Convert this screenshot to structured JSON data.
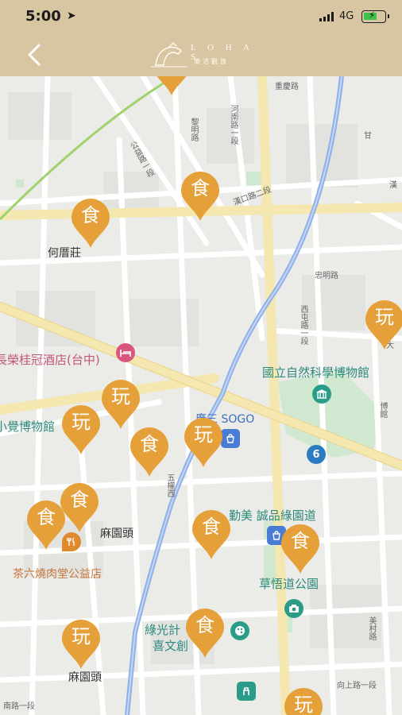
{
  "status_bar": {
    "time": "5:00",
    "network": "4G"
  },
  "header": {
    "logo_text": "L O H A S",
    "logo_subtitle": "樂活觀旅"
  },
  "map": {
    "labels": {
      "heli_zhuang": "何厝莊",
      "hotel": "長榮桂冠酒店(台中)",
      "museum_visual": "小覺博物館",
      "science_museum": "國立自然科學博物館",
      "sogo": "廣三 SOGO",
      "qinmei": "勤美 誠品綠園道",
      "matoutou_1": "麻園頭",
      "matoutou_2": "麻園頭",
      "tea_shop": "茶六燒肉堂公益店",
      "park": "草悟道公園",
      "green_light": "綠光計",
      "xiwen": "喜文創",
      "road_chongde": "重慶路",
      "road_hexin": "河南路一段",
      "road_liming": "黎明路",
      "road_gongyi": "公益路一段",
      "road_hankou": "漢口路二段",
      "road_zhongming": "忠明路",
      "road_ximing": "西屯路一段",
      "road_xiangshang": "向上路一段",
      "road_nan": "南路一段",
      "road_meicun": "美村路",
      "road_wuquan": "五權西",
      "road_boguan": "博館",
      "road_han": "漢",
      "road_da": "大",
      "road_gan": "甘",
      "badge_count": "6"
    },
    "pins": [
      {
        "label": "食",
        "type": "food"
      },
      {
        "label": "食",
        "type": "food"
      },
      {
        "label": "玩",
        "type": "play"
      },
      {
        "label": "玩",
        "type": "play"
      },
      {
        "label": "玩",
        "type": "play"
      },
      {
        "label": "食",
        "type": "food"
      },
      {
        "label": "玩",
        "type": "play"
      },
      {
        "label": "食",
        "type": "food"
      },
      {
        "label": "食",
        "type": "food"
      },
      {
        "label": "食",
        "type": "food"
      },
      {
        "label": "食",
        "type": "food"
      },
      {
        "label": "玩",
        "type": "play"
      },
      {
        "label": "食",
        "type": "food"
      },
      {
        "label": "玩",
        "type": "play"
      }
    ]
  },
  "colors": {
    "pin": "#e5a03a",
    "header": "#d8c6a2",
    "road_major": "#f5e7b0",
    "transit": "#8fb0e8"
  }
}
